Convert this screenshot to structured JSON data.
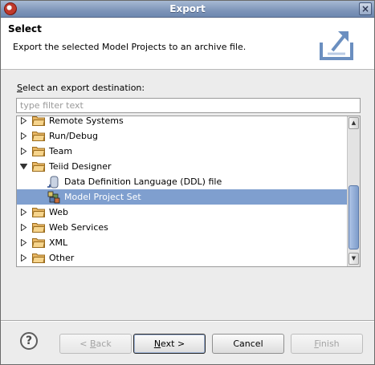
{
  "window": {
    "title": "Export"
  },
  "header": {
    "title": "Select",
    "description": "Export the selected Model Projects to an archive file.",
    "icon": "export-archive-icon"
  },
  "prompt": {
    "mnemonic": "S",
    "rest": "elect an export destination:"
  },
  "filter": {
    "placeholder": "type filter text",
    "value": ""
  },
  "tree": {
    "items": [
      {
        "label": "Remote Systems",
        "icon": "folder-icon",
        "expander": "collapsed",
        "level": 0,
        "selected": false
      },
      {
        "label": "Run/Debug",
        "icon": "folder-icon",
        "expander": "collapsed",
        "level": 0,
        "selected": false
      },
      {
        "label": "Team",
        "icon": "folder-icon",
        "expander": "collapsed",
        "level": 0,
        "selected": false
      },
      {
        "label": "Teiid Designer",
        "icon": "folder-icon",
        "expander": "expanded",
        "level": 0,
        "selected": false
      },
      {
        "label": "Data Definition Language (DDL) file",
        "icon": "ddl-file-icon",
        "expander": "none",
        "level": 1,
        "selected": false
      },
      {
        "label": "Model Project Set",
        "icon": "model-project-set-icon",
        "expander": "none",
        "level": 1,
        "selected": true
      },
      {
        "label": "Web",
        "icon": "folder-icon",
        "expander": "collapsed",
        "level": 0,
        "selected": false
      },
      {
        "label": "Web Services",
        "icon": "folder-icon",
        "expander": "collapsed",
        "level": 0,
        "selected": false
      },
      {
        "label": "XML",
        "icon": "folder-icon",
        "expander": "collapsed",
        "level": 0,
        "selected": false
      },
      {
        "label": "Other",
        "icon": "folder-icon",
        "expander": "collapsed",
        "level": 0,
        "selected": false
      }
    ]
  },
  "buttons": {
    "help": "?",
    "back": {
      "mnemonic": "B",
      "pre": "< ",
      "post": "ack"
    },
    "next": {
      "mnemonic": "N",
      "pre": "",
      "post": "ext >"
    },
    "cancel": "Cancel",
    "finish": {
      "mnemonic": "F",
      "pre": "",
      "post": "inish"
    }
  },
  "colors": {
    "selection": "#7f9fcf",
    "titlebar": "#7e95b9"
  }
}
